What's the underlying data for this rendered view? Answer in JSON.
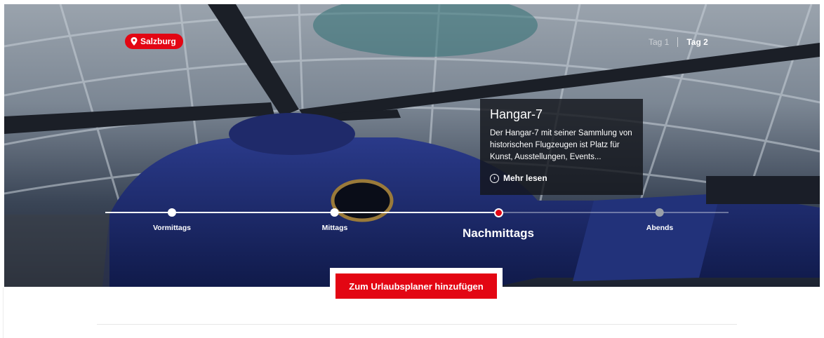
{
  "location": {
    "label": "Salzburg",
    "icon": "map-pin-icon"
  },
  "day_tabs": [
    {
      "label": "Tag 1",
      "active": false
    },
    {
      "label": "Tag 2",
      "active": true
    }
  ],
  "info_card": {
    "title": "Hangar-7",
    "text": "Der Hangar-7 mit seiner Sammlung von historischen Flugzeugen ist Platz für Kunst, Ausstellungen, Events...",
    "link_label": "Mehr lesen",
    "link_icon": "circle-arrow-right-icon"
  },
  "timeline": {
    "stops": [
      {
        "label": "Vormittags",
        "state": "done"
      },
      {
        "label": "Mittags",
        "state": "done"
      },
      {
        "label": "Nachmittags",
        "state": "current"
      },
      {
        "label": "Abends",
        "state": "future"
      }
    ]
  },
  "cta": {
    "label": "Zum Urlaubsplaner hinzufügen"
  },
  "colors": {
    "accent": "#e30613",
    "card_bg": "#14161c"
  }
}
